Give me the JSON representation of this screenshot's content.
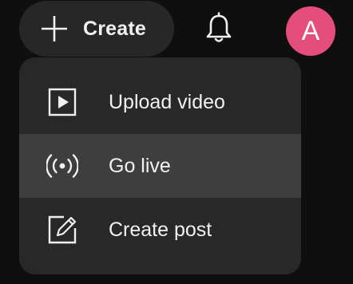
{
  "header": {
    "create_label": "Create",
    "create_icon": "plus-icon",
    "notifications_icon": "bell-icon",
    "avatar_letter": "A",
    "avatar_color": "#e54d7c"
  },
  "menu": {
    "items": [
      {
        "label": "Upload video",
        "icon": "upload-video-icon"
      },
      {
        "label": "Go live",
        "icon": "go-live-icon",
        "highlighted": true
      },
      {
        "label": "Create post",
        "icon": "create-post-icon"
      }
    ]
  },
  "colors": {
    "background": "#0f0f0f",
    "button_bg": "#272727",
    "menu_bg": "#282828",
    "menu_highlight": "#3e3e3e",
    "text": "#f1f1f1"
  }
}
